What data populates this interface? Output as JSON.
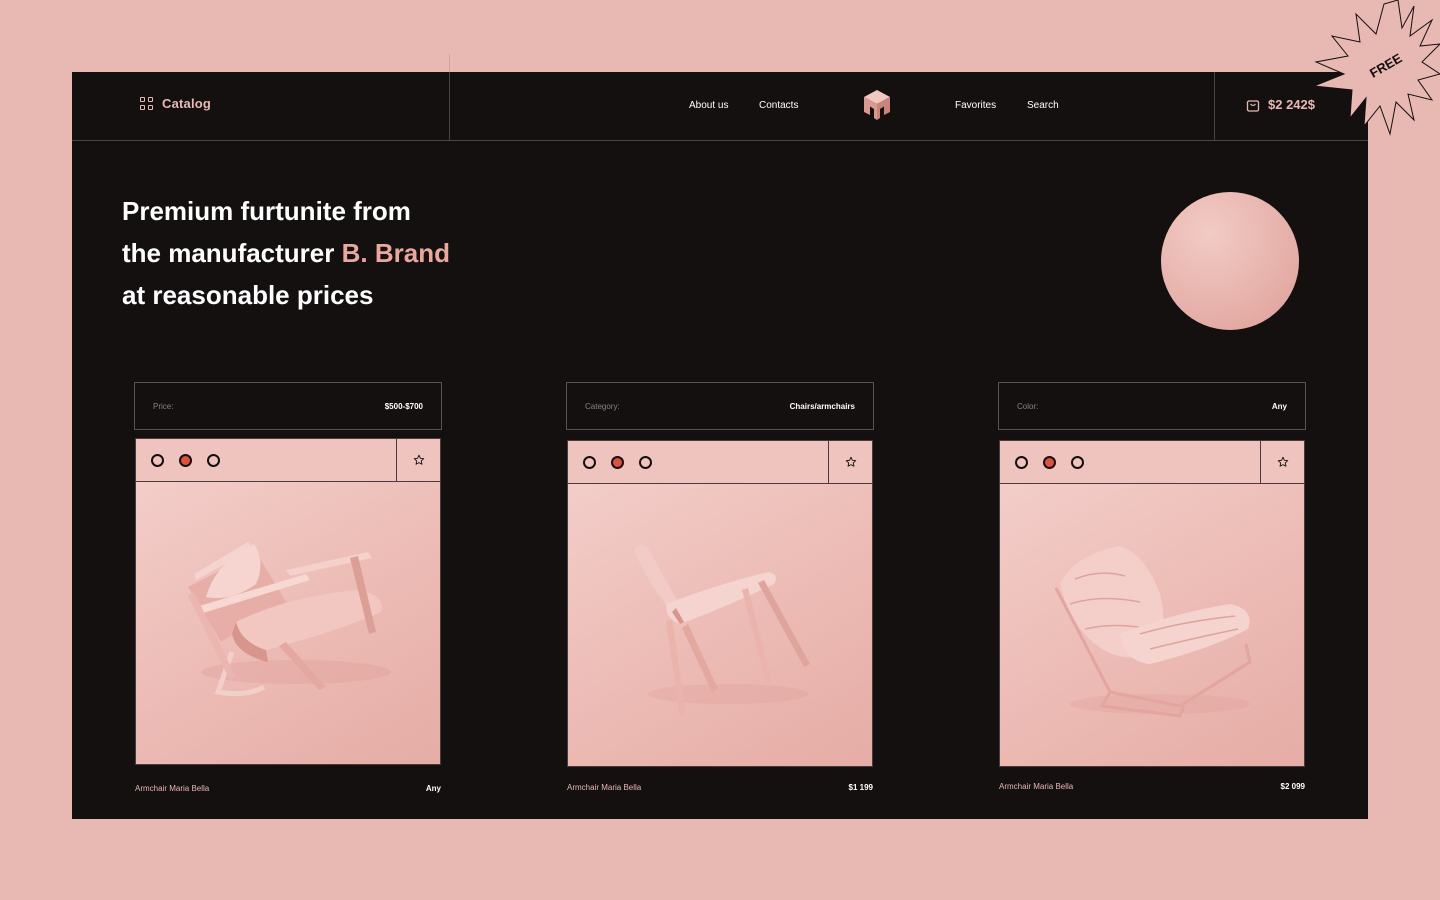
{
  "header": {
    "catalog_label": "Catalog",
    "nav_left": [
      "About us",
      "Contacts"
    ],
    "nav_right": [
      "Favorites",
      "Search"
    ],
    "cart_total": "$2 242$"
  },
  "badge": {
    "label": "FREE"
  },
  "hero": {
    "line1": "Premium furtunite from",
    "line2_prefix": "the manufacturer",
    "line2_brand": "B. Brand",
    "line3": "at reasonable prices"
  },
  "filters": [
    {
      "label": "Price:",
      "value": "$500-$700"
    },
    {
      "label": "Category:",
      "value": "Chairs/armchairs"
    },
    {
      "label": "Color:",
      "value": "Any"
    }
  ],
  "products": [
    {
      "name": "Armchair Maria Bella",
      "price": "Any"
    },
    {
      "name": "Armchair Maria Bella",
      "price": "$1 199"
    },
    {
      "name": "Armchair Maria Bella",
      "price": "$2 099"
    }
  ],
  "colors": {
    "background": "#e8b8b2",
    "panel": "#141010",
    "accent": "#e8a89e",
    "active_dot": "#e0503e"
  }
}
